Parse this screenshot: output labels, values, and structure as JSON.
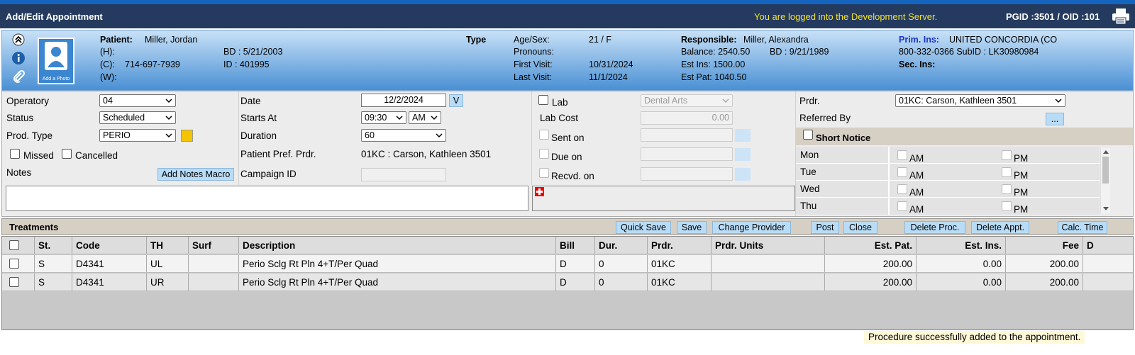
{
  "header": {
    "title": "Add/Edit Appointment",
    "dev_notice": "You are logged into the Development Server.",
    "pgid": "PGID :3501  /  OID :101"
  },
  "patient": {
    "photo_label": "Add a Photo",
    "patient_label": "Patient:",
    "patient_name": "Miller, Jordan",
    "h_label": "(H):",
    "c_label": "(C):",
    "c_value": "714-697-7939",
    "w_label": "(W):",
    "bd": "BD : 5/21/2003",
    "id": "ID : 401995",
    "type_label": "Type",
    "agesex_label": "Age/Sex:",
    "agesex_value": "21 / F",
    "pronouns_label": "Pronouns:",
    "first_visit_label": "First Visit:",
    "first_visit_value": "10/31/2024",
    "last_visit_label": "Last Visit:",
    "last_visit_value": "11/1/2024",
    "responsible_label": "Responsible:",
    "responsible_value": "Miller, Alexandra",
    "balance": "Balance: 2540.50",
    "resp_bd": "BD : 9/21/1989",
    "est_ins": "Est Ins:  1500.00",
    "est_pat": "Est Pat:  1040.50",
    "prim_ins_label": "Prim. Ins:",
    "prim_ins_value": "UNITED CONCORDIA (CO",
    "ins_phone": "800-332-0366 SubID : LK30980984",
    "sec_ins_label": "Sec. Ins:"
  },
  "form": {
    "operatory_label": "Operatory",
    "operatory_value": "04",
    "status_label": "Status",
    "status_value": "Scheduled",
    "prod_type_label": "Prod. Type",
    "prod_type_value": "PERIO",
    "prod_color": "#f5c400",
    "missed_label": "Missed",
    "cancelled_label": "Cancelled",
    "notes_label": "Notes",
    "add_notes_macro": "Add Notes Macro",
    "date_label": "Date",
    "date_value": "12/2/2024",
    "date_btn": "V",
    "starts_label": "Starts At",
    "starts_time": "09:30",
    "starts_ampm": "AM",
    "duration_label": "Duration",
    "duration_value": "60",
    "pref_prdr_label": "Patient Pref. Prdr.",
    "pref_prdr_value": "01KC : Carson, Kathleen 3501",
    "campaign_label": "Campaign ID",
    "lab_label": "Lab",
    "lab_value": "Dental Arts",
    "lab_cost_label": "Lab Cost",
    "lab_cost_value": "0.00",
    "sent_label": "Sent on",
    "due_label": "Due on",
    "recvd_label": "Recvd. on",
    "prdr_label": "Prdr.",
    "prdr_value": "01KC: Carson, Kathleen 3501",
    "referred_label": "Referred By",
    "referred_btn": "...",
    "short_notice_label": "Short Notice",
    "days": [
      {
        "day": "Mon",
        "am": "AM",
        "pm": "PM"
      },
      {
        "day": "Tue",
        "am": "AM",
        "pm": "PM"
      },
      {
        "day": "Wed",
        "am": "AM",
        "pm": "PM"
      },
      {
        "day": "Thu",
        "am": "AM",
        "pm": "PM"
      }
    ]
  },
  "toolbar": {
    "title": "Treatments",
    "quick_save": "Quick Save",
    "save": "Save",
    "change_provider": "Change Provider",
    "post": "Post",
    "close": "Close",
    "delete_proc": "Delete Proc.",
    "delete_appt": "Delete Appt.",
    "calc_time": "Calc. Time"
  },
  "table": {
    "headers": [
      "St.",
      "Code",
      "TH",
      "Surf",
      "Description",
      "Bill",
      "Dur.",
      "Prdr.",
      "Prdr. Units",
      "Est. Pat.",
      "Est. Ins.",
      "Fee",
      "D"
    ],
    "rows": [
      [
        "S",
        "D4341",
        "UL",
        "",
        "Perio Sclg Rt Pln 4+T/Per Quad",
        "D",
        "0",
        "01KC",
        "",
        "200.00",
        "0.00",
        "200.00",
        ""
      ],
      [
        "S",
        "D4341",
        "UR",
        "",
        "Perio Sclg Rt Pln 4+T/Per Quad",
        "D",
        "0",
        "01KC",
        "",
        "200.00",
        "0.00",
        "200.00",
        ""
      ]
    ]
  },
  "status_message": "Procedure successfully added to the appointment."
}
